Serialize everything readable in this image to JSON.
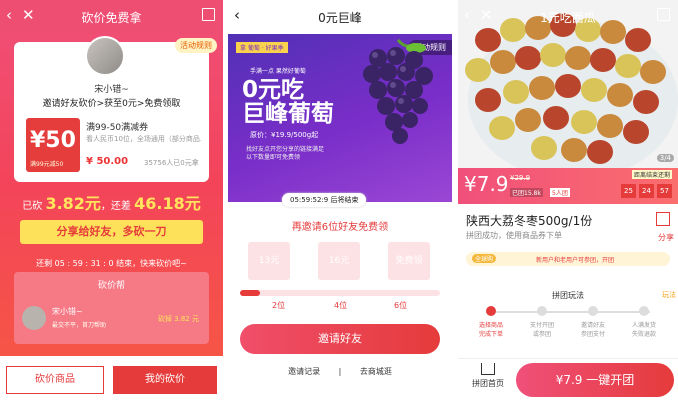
{
  "screen1": {
    "title": "砍价免费拿",
    "rules": "活动规则",
    "user": "宋小错~",
    "invite": "邀请好友砍价>获至0元>免费领取",
    "coupon_amount": "¥50",
    "coupon_sub": "满99元减50",
    "coupon_title": "满99-50满减券",
    "coupon_desc": "看人民币10位，全场通用（部分商品...",
    "coupon_price": "¥ 50.00",
    "sold": "35756人已0元拿",
    "cut_prefix": "已砍",
    "cut_done": "3.82元",
    "cut_mid": "，还差",
    "cut_left": "46.18元",
    "share": "分享给好友，多砍一刀",
    "timer": "还剩 05 : 59 : 31 : 0 结束，快来砍价吧~",
    "helpers_title": "砍价帮",
    "helper_name": "宋小错~",
    "helper_sub": "最交不平，首刀帮助",
    "helper_amount": "砍掉 3.82 元",
    "btn_goods": "砍价商品",
    "btn_mine": "我的砍价"
  },
  "screen2": {
    "title": "0元巨峰",
    "rules": "活动规则",
    "tag": "拿 葡萄 · 好果季",
    "slogan": "手满一点  果然好葡萄",
    "big1": "0元吃",
    "big2": "巨峰葡萄",
    "orig": "原价：¥19.9/500g起",
    "note": "找好友点开您分享的链接满足以下数量即可免费领",
    "countdown": "05:59:52:9 后将结束",
    "invite6": "再邀请6位好友免费领",
    "slot1": "13元",
    "slot2": "16元",
    "slot3": "免费领",
    "progress": 0.1,
    "tick1": "2位",
    "tick2": "4位",
    "tick3": "6位",
    "invite_btn": "邀请好友",
    "link1": "邀请记录",
    "link_sep": "|",
    "link2": "去商城逛"
  },
  "screen3": {
    "title": "1元吃西瓜",
    "photo_idx": "3/4",
    "price": "¥7.9",
    "orig": "¥29.9",
    "sold": "已团15.8k",
    "group": "5人团",
    "ends": "距离结束还剩",
    "cd": [
      "25",
      "24",
      "57"
    ],
    "name": "陕西大荔冬枣500g/1份",
    "sub": "拼团成功，使用商品券下单",
    "share": "分享",
    "strip_tag": "全球购",
    "strip_text": "新用户和老用户可参团，开团",
    "group_title": "拼团玩法",
    "play": "玩法",
    "steps": [
      "选择商品\n完成下单",
      "支付开团\n或参团",
      "邀请好友\n参团支付",
      "人满发货\n失败退款"
    ],
    "home": "拼团首页",
    "open_btn": "¥7.9  一键开团"
  }
}
